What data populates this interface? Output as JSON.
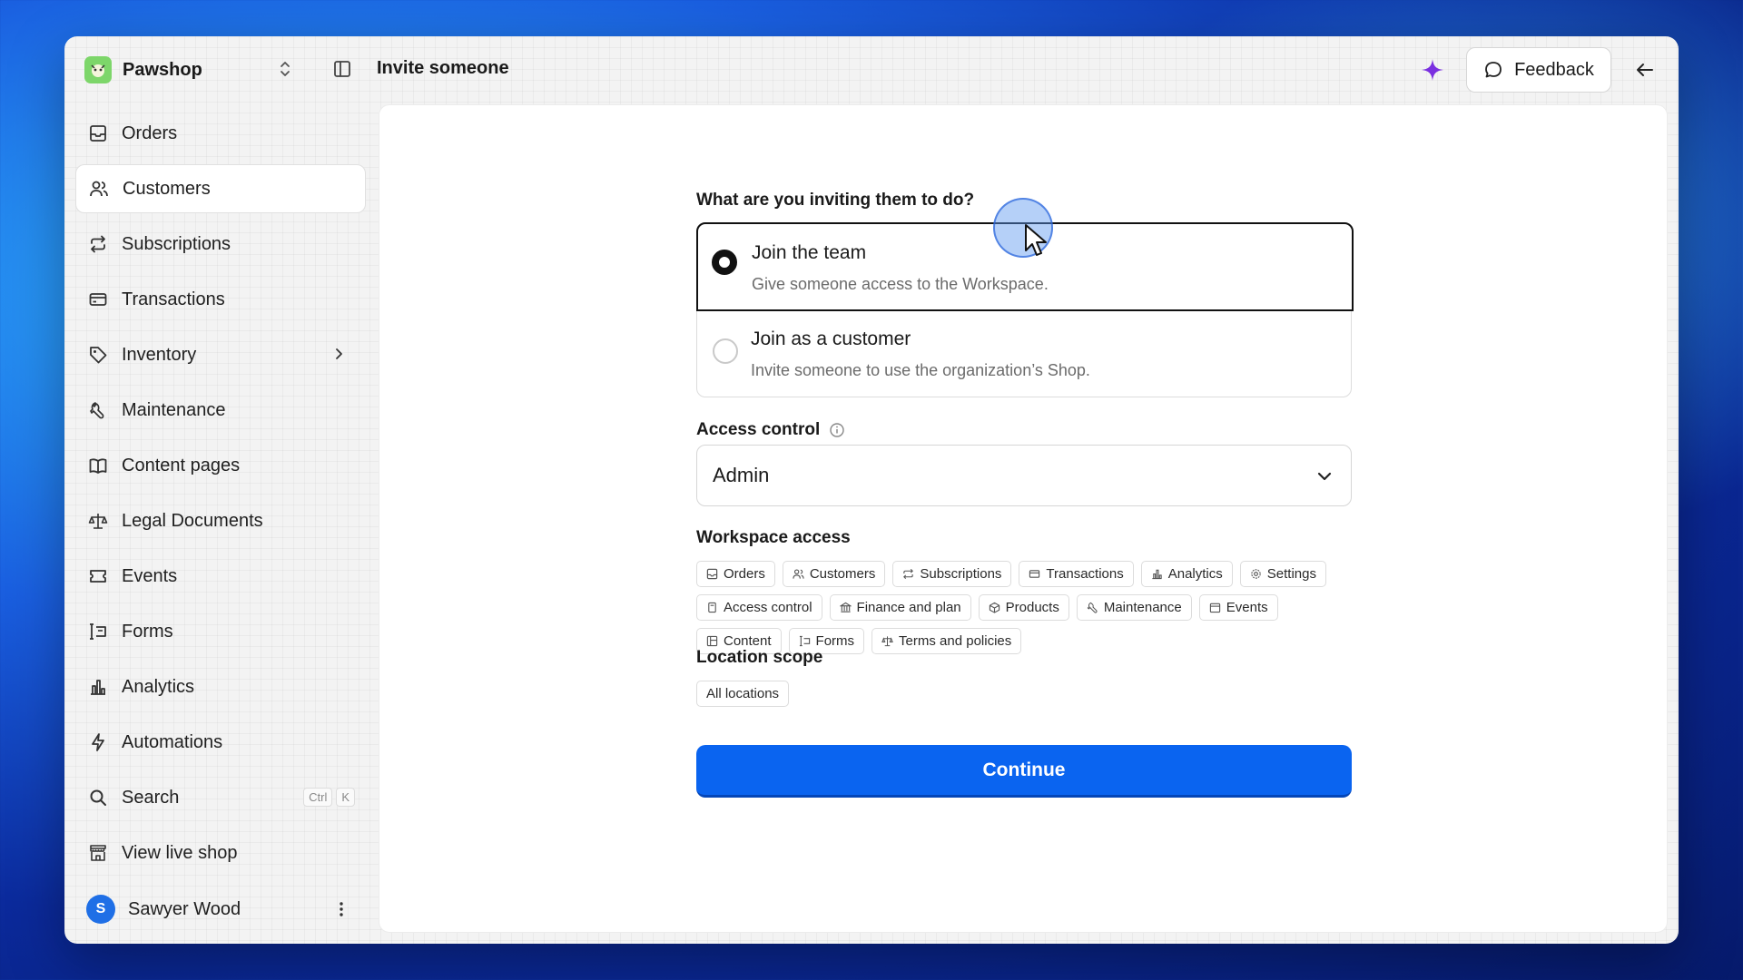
{
  "app": {
    "name": "Pawshop",
    "page_title": "Invite someone"
  },
  "header": {
    "feedback_label": "Feedback"
  },
  "sidebar": {
    "items": [
      {
        "label": "Orders",
        "icon": "inbox-icon"
      },
      {
        "label": "Customers",
        "icon": "users-icon",
        "active": true
      },
      {
        "label": "Subscriptions",
        "icon": "repeat-icon"
      },
      {
        "label": "Transactions",
        "icon": "card-icon"
      },
      {
        "label": "Inventory",
        "icon": "tag-icon"
      },
      {
        "label": "Maintenance",
        "icon": "wrench-icon"
      },
      {
        "label": "Content pages",
        "icon": "book-icon"
      },
      {
        "label": "Legal Documents",
        "icon": "scale-icon"
      },
      {
        "label": "Events",
        "icon": "ticket-icon"
      },
      {
        "label": "Forms",
        "icon": "form-icon"
      },
      {
        "label": "Analytics",
        "icon": "bar-chart-icon"
      },
      {
        "label": "Automations",
        "icon": "bolt-icon"
      }
    ],
    "search_label": "Search",
    "search_keys": [
      "Ctrl",
      "K"
    ],
    "live_shop_label": "View live shop",
    "user": {
      "initial": "S",
      "name": "Sawyer Wood"
    }
  },
  "form": {
    "question": "What are you inviting them to do?",
    "options": [
      {
        "title": "Join the team",
        "desc": "Give someone access to the Workspace.",
        "selected": true
      },
      {
        "title": "Join as a customer",
        "desc": "Invite someone to use the organization’s Shop.",
        "selected": false
      }
    ],
    "access_label": "Access control",
    "access_value": "Admin",
    "workspace_label": "Workspace access",
    "workspace_chips": [
      "Orders",
      "Customers",
      "Subscriptions",
      "Transactions",
      "Analytics",
      "Settings",
      "Access control",
      "Finance and plan",
      "Products",
      "Maintenance",
      "Events",
      "Content",
      "Forms",
      "Terms and policies"
    ],
    "location_label": "Location scope",
    "location_chips": [
      "All locations"
    ],
    "continue_label": "Continue"
  },
  "colors": {
    "primary": "#0a64f0",
    "accent_sparkle": "#7a2fe0",
    "avatar": "#1f6fe6"
  }
}
